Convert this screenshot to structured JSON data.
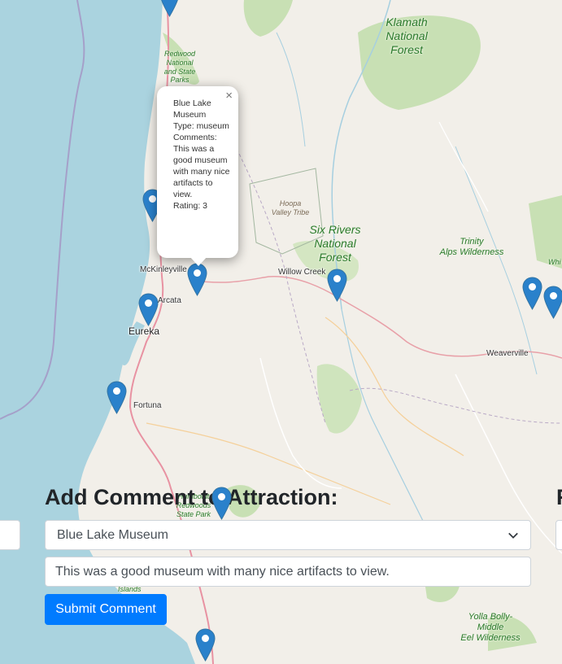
{
  "map": {
    "places": {
      "mckinleyville": "McKinleyville",
      "arcata": "Arcata",
      "eureka": "Eureka",
      "fortuna": "Fortuna",
      "willow_creek": "Willow Creek",
      "weaverville": "Weaverville"
    },
    "areas": {
      "klamath": "Klamath\nNational\nForest",
      "redwood": "Redwood\nNational\nand State\nParks",
      "hoopa": "Hoopa\nValley Tribe",
      "six_rivers": "Six Rivers\nNational\nForest",
      "trinity_alps": "Trinity\nAlps Wilderness",
      "humboldt_redwoods": "Humboldt\nRedwoods\nState Park",
      "yolla_bolly": "Yolla Bolly-\nMiddle\nEel Wilderness",
      "islands": "Islands",
      "white_edge": "Whi"
    },
    "marker_icon": "map-pin-icon"
  },
  "popup": {
    "close_label": "×",
    "lines": [
      "Blue Lake Museum",
      "Type: museum",
      "Comments: This was a good museum with many nice artifacts to view.",
      "Rating: 3"
    ]
  },
  "form": {
    "title": "Add Comment to Attraction:",
    "title_right_fragment": "R",
    "attraction_select_value": "Blue Lake Museum",
    "comment_value": "This was a good museum with many nice artifacts to view.",
    "submit_label": "Submit Comment"
  },
  "colors": {
    "water": "#aad3df",
    "land": "#f2efe9",
    "forest": "#c8e0b4",
    "primary_button": "#007bff",
    "marker": "#2a81cb"
  }
}
